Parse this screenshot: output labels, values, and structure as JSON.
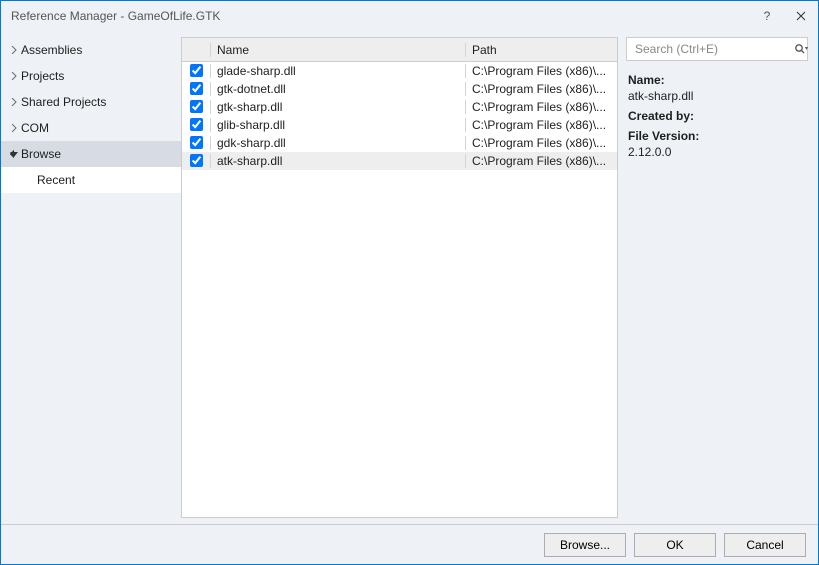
{
  "titlebar": {
    "title": "Reference Manager - GameOfLife.GTK",
    "help": "?",
    "close": "✕"
  },
  "sidebar": {
    "items": [
      {
        "label": "Assemblies",
        "expanded": false
      },
      {
        "label": "Projects",
        "expanded": false
      },
      {
        "label": "Shared Projects",
        "expanded": false
      },
      {
        "label": "COM",
        "expanded": false
      },
      {
        "label": "Browse",
        "expanded": true
      }
    ],
    "sub_recent": "Recent"
  },
  "grid": {
    "header_name": "Name",
    "header_path": "Path",
    "rows": [
      {
        "name": "glade-sharp.dll",
        "path": "C:\\Program Files (x86)\\..."
      },
      {
        "name": "gtk-dotnet.dll",
        "path": "C:\\Program Files (x86)\\..."
      },
      {
        "name": "gtk-sharp.dll",
        "path": "C:\\Program Files (x86)\\..."
      },
      {
        "name": "glib-sharp.dll",
        "path": "C:\\Program Files (x86)\\..."
      },
      {
        "name": "gdk-sharp.dll",
        "path": "C:\\Program Files (x86)\\..."
      },
      {
        "name": "atk-sharp.dll",
        "path": "C:\\Program Files (x86)\\..."
      }
    ],
    "selected_index": 5
  },
  "search": {
    "placeholder": "Search (Ctrl+E)"
  },
  "details": {
    "name_label": "Name:",
    "name_value": "atk-sharp.dll",
    "created_label": "Created by:",
    "created_value": "",
    "version_label": "File Version:",
    "version_value": "2.12.0.0"
  },
  "footer": {
    "browse": "Browse...",
    "ok": "OK",
    "cancel": "Cancel"
  }
}
